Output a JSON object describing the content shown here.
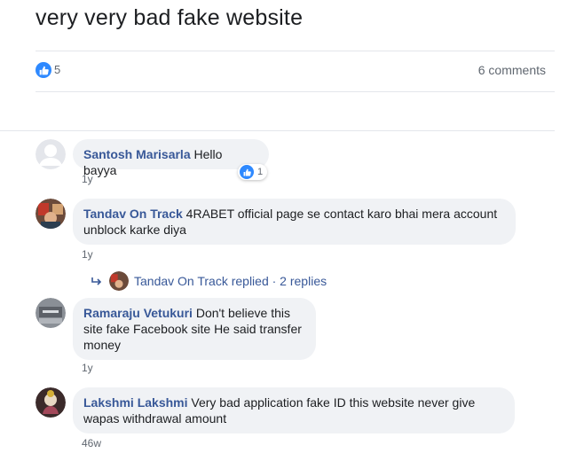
{
  "post": {
    "text": "very very bad fake website"
  },
  "stats": {
    "likes": "5",
    "comments": "6 comments"
  },
  "comments": [
    {
      "author": "Santosh Marisarla",
      "text": "Hello bayya",
      "time": "1y",
      "reaction_count": "1"
    },
    {
      "author": "Tandav On Track",
      "text": "4RABET official page se contact karo bhai mera account unblock karke diya",
      "time": "1y"
    },
    {
      "author": "Ramaraju Vetukuri",
      "text": "Don't believe this site fake Facebook site He said transfer money",
      "time": "1y"
    },
    {
      "author": "Lakshmi Lakshmi",
      "text": "Very bad application fake ID this website never give wapas withdrawal amount",
      "time": "46w"
    }
  ],
  "replies": {
    "text": "Tandav On Track replied · 2 replies"
  },
  "colors": {
    "link": "#385898",
    "bubble": "#f0f2f5",
    "like": "#2e89ff",
    "muted": "#606770"
  },
  "icons": {
    "like": "thumbs-up-icon",
    "reply": "reply-arrow-icon"
  }
}
